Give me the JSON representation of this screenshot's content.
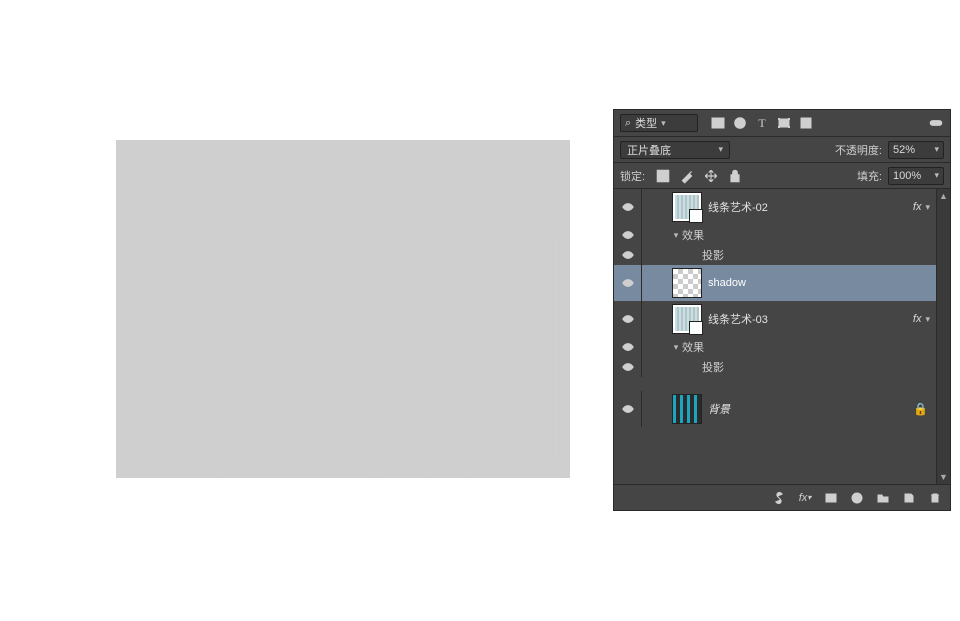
{
  "canvas": {
    "stripe_color": "#1da5bf",
    "bg_color": "#2b2b2b"
  },
  "panel": {
    "filter_row": {
      "search_glyph": "⌕",
      "filter_label": "类型"
    },
    "blend_row": {
      "blend_mode": "正片叠底",
      "opacity_label": "不透明度:",
      "opacity_value": "52%"
    },
    "lock_row": {
      "lock_label": "锁定:",
      "fill_label": "填充:",
      "fill_value": "100%"
    },
    "layers": [
      {
        "id": "layer-lineart-02",
        "name": "线条艺术-02",
        "thumb": "smart",
        "has_fx": true,
        "selected": false,
        "children": [
          {
            "kind": "group",
            "label": "效果"
          },
          {
            "kind": "fx",
            "label": "投影"
          }
        ]
      },
      {
        "id": "layer-shadow",
        "name": "shadow",
        "thumb": "transparent",
        "has_fx": false,
        "selected": true,
        "children": []
      },
      {
        "id": "layer-lineart-03",
        "name": "线条艺术-03",
        "thumb": "smart",
        "has_fx": true,
        "selected": false,
        "children": [
          {
            "kind": "group",
            "label": "效果"
          },
          {
            "kind": "fx",
            "label": "投影"
          }
        ]
      },
      {
        "id": "layer-bg",
        "name": "背景",
        "thumb": "stripes",
        "has_fx": false,
        "locked": true,
        "selected": false,
        "italic": true,
        "children": []
      }
    ],
    "footer_icons": [
      "link-icon",
      "fx-icon",
      "mask-icon",
      "adjustment-icon",
      "group-icon",
      "new-layer-icon",
      "trash-icon"
    ]
  }
}
